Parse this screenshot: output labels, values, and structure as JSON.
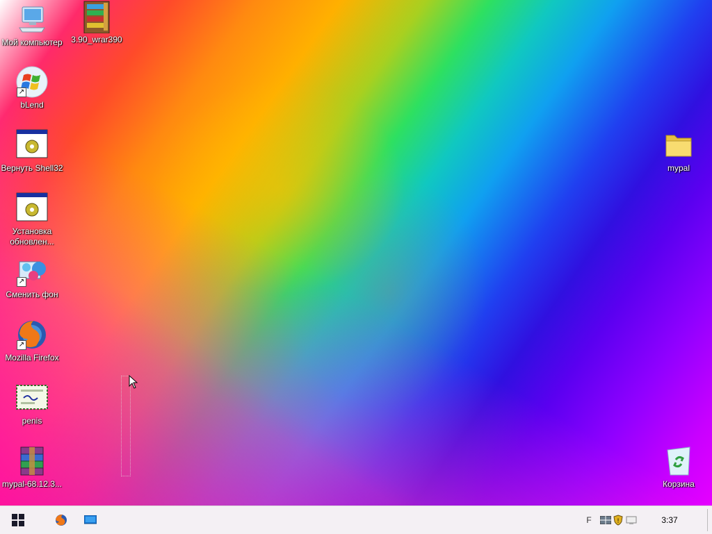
{
  "desktop": {
    "icons": [
      {
        "label": "Мой компьютер",
        "icon": "computer-icon"
      },
      {
        "label": "3.90_wrar390",
        "icon": "winrar-archive-icon"
      },
      {
        "label": "bLend",
        "icon": "windows-logo-icon"
      },
      {
        "label": "Вернуть Shell32",
        "icon": "application-gear-icon"
      },
      {
        "label": "Установка обновлен...",
        "icon": "application-gear-icon"
      },
      {
        "label": "Сменить фон",
        "icon": "change-wallpaper-icon"
      },
      {
        "label": "Mozilla Firefox",
        "icon": "firefox-icon"
      },
      {
        "label": "penis",
        "icon": "certificate-icon"
      },
      {
        "label": "mypal-68.12.3...",
        "icon": "winrar-archive-icon"
      },
      {
        "label": "mypal",
        "icon": "folder-icon"
      },
      {
        "label": "Корзина",
        "icon": "recycle-bin-icon"
      }
    ]
  },
  "taskbar": {
    "start": "start-windows-icon",
    "pinned": [
      "firefox-icon",
      "show-desktop-icon"
    ],
    "tray_text": "F",
    "clock": "3:37"
  },
  "colors": {
    "taskbar_bg": "#f4f0f4",
    "label_color": "#ffffff"
  }
}
